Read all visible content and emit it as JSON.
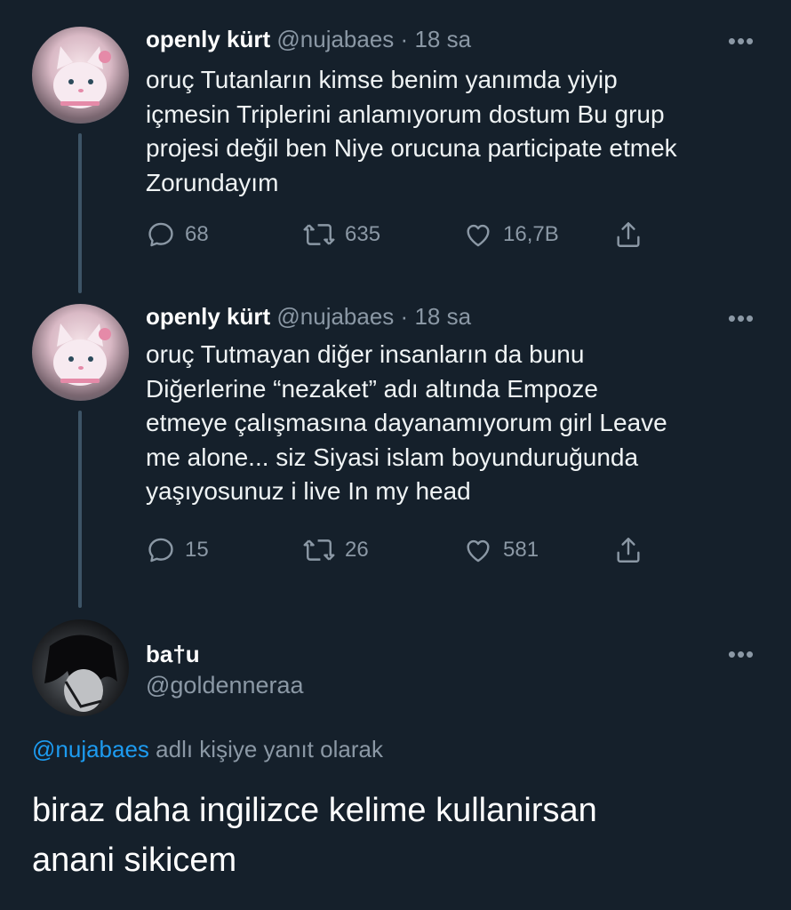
{
  "tweets": [
    {
      "name": "openly kürt",
      "handle": "@nujabaes",
      "separator": "·",
      "time": "18 sa",
      "avatar_icon": "cat-avatar-icon",
      "lines": [
        "oruç Tutanların kimse benim yanımda yiyip",
        "içmesin Triplerini anlamıyorum dostum Bu grup",
        "projesi değil ben Niye orucuna participate etmek",
        "Zorundayım"
      ],
      "stats": {
        "replies": "68",
        "retweets": "635",
        "likes": "16,7B"
      }
    },
    {
      "name": "openly kürt",
      "handle": "@nujabaes",
      "separator": "·",
      "time": "18 sa",
      "avatar_icon": "cat-avatar-icon",
      "lines": [
        "oruç Tutmayan diğer insanların da bunu",
        "Diğerlerine “nezaket” adı altında Empoze",
        "etmeye çalışmasına dayanamıyorum girl Leave",
        "me alone... siz Siyasi islam boyunduruğunda",
        "yaşıyosunuz i live In my head"
      ],
      "stats": {
        "replies": "15",
        "retweets": "26",
        "likes": "581"
      }
    }
  ],
  "reply": {
    "name": "ba†u",
    "handle": "@goldenneraa",
    "avatar_icon": "anime-avatar-icon",
    "reply_mention": "@nujabaes",
    "reply_suffix": " adlı kişiye yanıt olarak",
    "lines": [
      "biraz daha ingilizce kelime kullanirsan",
      "anani sikicem"
    ]
  },
  "more_label": "•••",
  "colors": {
    "background": "#15202b",
    "text": "#e7e9ea",
    "muted": "#8b98a5",
    "accent": "#1d9bf0",
    "thread_line": "#3d5466"
  }
}
